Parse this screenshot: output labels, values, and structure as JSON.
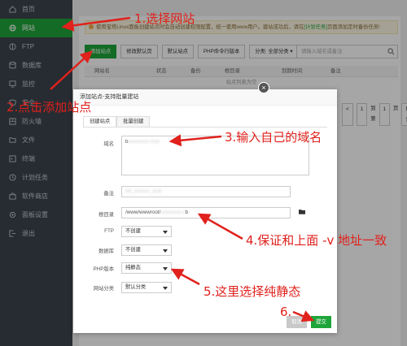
{
  "sidebar": {
    "items": [
      {
        "label": "首页",
        "icon": "home-icon"
      },
      {
        "label": "网站",
        "icon": "globe-icon",
        "active": true
      },
      {
        "label": "FTP",
        "icon": "ftp-icon"
      },
      {
        "label": "数据库",
        "icon": "database-icon"
      },
      {
        "label": "监控",
        "icon": "monitor-icon"
      },
      {
        "label": "安全",
        "icon": "shield-icon"
      },
      {
        "label": "防火墙",
        "icon": "firewall-icon"
      },
      {
        "label": "文件",
        "icon": "folder-icon"
      },
      {
        "label": "终端",
        "icon": "terminal-icon"
      },
      {
        "label": "计划任务",
        "icon": "clock-icon"
      },
      {
        "label": "软件商店",
        "icon": "store-icon"
      },
      {
        "label": "面板设置",
        "icon": "settings-icon"
      },
      {
        "label": "退出",
        "icon": "logout-icon"
      }
    ]
  },
  "notice": {
    "text": "使用宝塔Linux面板创建站点时会自动创建权限配置，统一使用www用户。建站成功后，请在",
    "link": "[计划任务]",
    "tail": "页面添加定时备份任务!"
  },
  "toolbar": {
    "add_site": "添加站点",
    "default_page": "修改默认页",
    "default_site": "默认站点",
    "php_cli": "PHP命令行版本",
    "category": "分类: 全部分类",
    "search_placeholder": "请输入域名或备注"
  },
  "table": {
    "headers": [
      "网站名",
      "状态",
      "备份",
      "根目录",
      "到期时间",
      "备注"
    ],
    "empty": "站点列表为空",
    "pager": {
      "prefix": "<",
      "page": "1",
      "goto": "到第",
      "input": "1",
      "unit": "页",
      "confirm": "确认"
    }
  },
  "modal": {
    "title": "添加站点-支持批量建站",
    "close": "×",
    "tabs": [
      "创建站点",
      "批量创建"
    ],
    "fields": {
      "domain_label": "域名",
      "domain_value": "b",
      "note_label": "备注",
      "root_label": "根目录",
      "root_value": "/www/wwwroot/",
      "root_tail": "b",
      "ftp_label": "FTP",
      "ftp_value": "不创建",
      "db_label": "数据库",
      "db_value": "不创建",
      "php_label": "PHP版本",
      "php_value": "纯静态",
      "category_label": "网站分类",
      "category_value": "默认分类"
    },
    "cancel": "取消",
    "submit": "提交"
  },
  "annotations": [
    "1.选择网站",
    "2.点击添加站点",
    "3.输入自己的域名",
    "4.保证和上面 -v 地址一致",
    "5.这里选择纯静态",
    "6."
  ],
  "colors": {
    "accent": "#20a53a",
    "sidebar_bg": "#3c444d",
    "annotation": "#e0211c"
  }
}
